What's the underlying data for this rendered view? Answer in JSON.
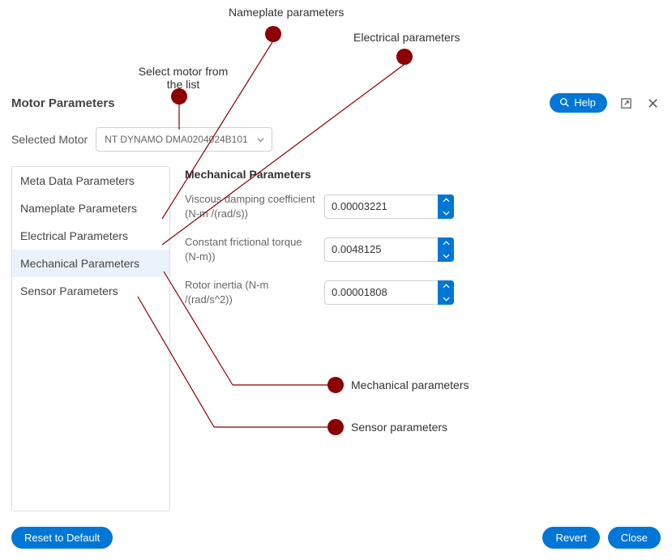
{
  "header": {
    "title": "Motor Parameters",
    "help_label": "Help"
  },
  "selected_motor": {
    "label": "Selected Motor",
    "value": "NT DYNAMO DMA0204024B101"
  },
  "sidebar": {
    "items": [
      {
        "label": "Meta Data Parameters"
      },
      {
        "label": "Nameplate Parameters"
      },
      {
        "label": "Electrical Parameters"
      },
      {
        "label": "Mechanical Parameters"
      },
      {
        "label": "Sensor Parameters"
      }
    ],
    "active_index": 3
  },
  "panel": {
    "title": "Mechanical Parameters",
    "rows": [
      {
        "label": "Viscous damping coefficient (N-m /(rad/s))",
        "value": "0.00003221"
      },
      {
        "label": "Constant frictional torque (N-m))",
        "value": "0.0048125"
      },
      {
        "label": "Rotor inertia (N-m /(rad/s^2))",
        "value": "0.00001808"
      }
    ]
  },
  "footer": {
    "reset_label": "Reset to Default",
    "revert_label": "Revert",
    "close_label": "Close"
  },
  "callouts": {
    "select_motor": "Select motor from the list",
    "nameplate": "Nameplate parameters",
    "electrical": "Electrical parameters",
    "mechanical": "Mechanical parameters",
    "sensor": "Sensor parameters"
  }
}
